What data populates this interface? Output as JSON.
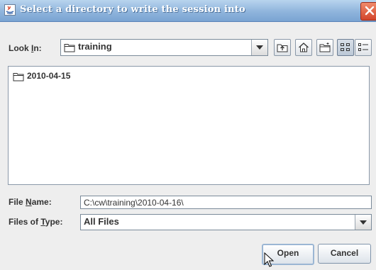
{
  "window": {
    "title": "Select a directory to write the session into"
  },
  "look_in": {
    "label": "Look In:",
    "mnemonic": "I",
    "value": "training"
  },
  "toolbar": {
    "up_icon": "up-folder-icon",
    "home_icon": "home-icon",
    "new_folder_icon": "new-folder-icon",
    "list_icon": "list-view-icon",
    "details_icon": "details-view-icon"
  },
  "files": [
    {
      "name": "2010-04-15",
      "icon": "folder-icon"
    }
  ],
  "file_name": {
    "label": "File Name:",
    "value": "C:\\cw\\training\\2010-04-16\\"
  },
  "files_of_type": {
    "label": "Files of Type:",
    "value": "All Files"
  },
  "buttons": {
    "open": "Open",
    "cancel": "Cancel"
  },
  "colors": {
    "titlebar": "#8fb4dc",
    "close": "#d2452b",
    "background": "#eeeeee"
  }
}
